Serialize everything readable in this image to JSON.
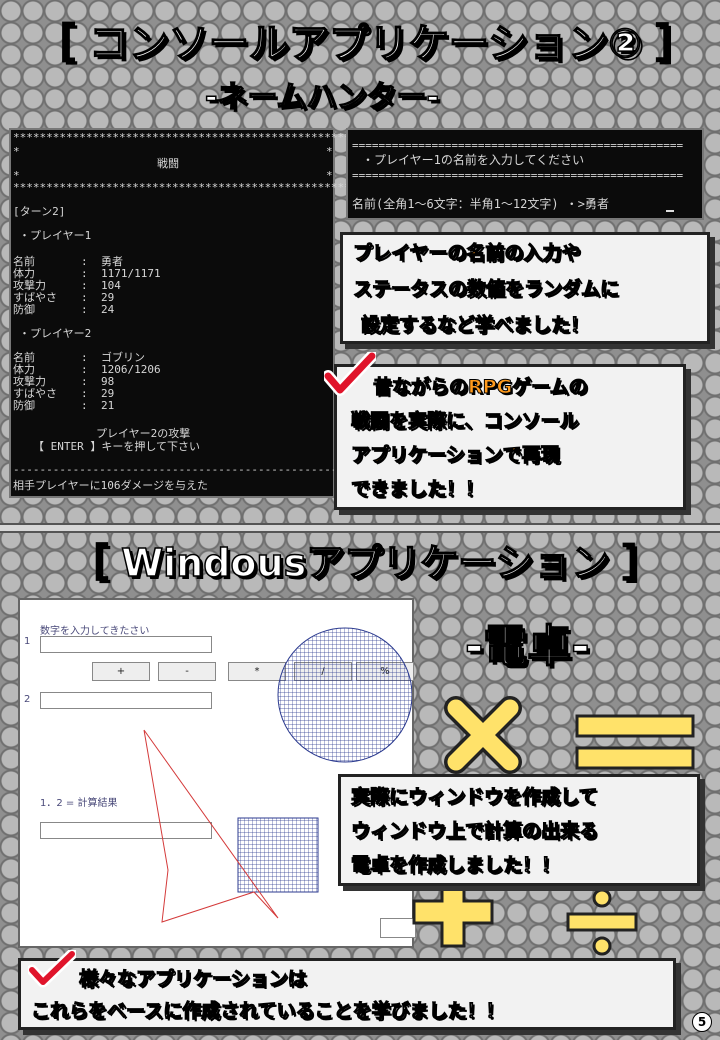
{
  "section1": {
    "title": "［ コンソールアプリケーション② ］",
    "subtitle": "-ネームハンター-"
  },
  "battle_console": {
    "stars": "*****************************************************",
    "edge": "*",
    "heading": "戦闘",
    "turn": "[ターン2]",
    "p1_header": "・プレイヤー1",
    "p1_rows": [
      {
        "k": "名前",
        "v": "勇者"
      },
      {
        "k": "体力",
        "v": "1171/1171"
      },
      {
        "k": "攻撃力",
        "v": "104"
      },
      {
        "k": "すばやさ",
        "v": "29"
      },
      {
        "k": "防御",
        "v": "24"
      }
    ],
    "p2_header": "・プレイヤー2",
    "p2_rows": [
      {
        "k": "名前",
        "v": "ゴブリン"
      },
      {
        "k": "体力",
        "v": "1206/1206"
      },
      {
        "k": "攻撃力",
        "v": "98"
      },
      {
        "k": "すばやさ",
        "v": "29"
      },
      {
        "k": "防御",
        "v": "21"
      }
    ],
    "attack_msg": "プレイヤー2の攻撃",
    "enter_msg": "【 ENTER 】キーを押して下さい",
    "dashes": "-----------------------------------------------------",
    "damage_msg": "相手プレイヤーに106ダメージを与えた"
  },
  "name_console": {
    "rule": "==================================================",
    "prompt": "・プレイヤー1の名前を入力してください",
    "input_line": "名前(全角1〜6文字：半角1〜12文字) ・>勇者"
  },
  "callout1": {
    "line1a": "プレイヤーの名前の入力",
    "line1b": "や",
    "line2a": "ステータスの数値をランダム",
    "line2b": "に",
    "line3": "設定するなど学べました！"
  },
  "callout2": {
    "line1a": "昔ながらの",
    "line1b": "RPGゲーム",
    "line1c": "の",
    "line2a": "戦闘を実際に、",
    "line2b": "コンソール",
    "line3a": "アプリケーションで再現",
    "line4": "できました！！"
  },
  "section2": {
    "title": "［ Windousアプリケーション ］",
    "subtitle": "-電卓-"
  },
  "calc_window": {
    "instruction": "数字を入力してきたさい",
    "label1": "1",
    "label2": "2",
    "buttons": [
      "+",
      "-",
      "*",
      "/",
      "%"
    ],
    "result_label": "1．2 = 計算結果"
  },
  "callout3": {
    "line1a": "実際に",
    "line1b": "ウィンドウ",
    "line1c": "を",
    "line1d": "作成",
    "line1e": "して",
    "line2": "ウィンドウ上で計算の出来る",
    "line3a": "電卓",
    "line3b": "を",
    "line3c": "作成",
    "line3d": "しました！！"
  },
  "callout4": {
    "line1": "様々なアプリケーションは",
    "line2a": "これらを",
    "line2b": "ベース",
    "line2c": "に",
    "line2d": "作成",
    "line2e": "されていることを学びました！！"
  },
  "page_number": "5",
  "colors": {
    "accent": "#ff9a1c",
    "symbol": "#ffe26a",
    "check": "#e0142b"
  }
}
